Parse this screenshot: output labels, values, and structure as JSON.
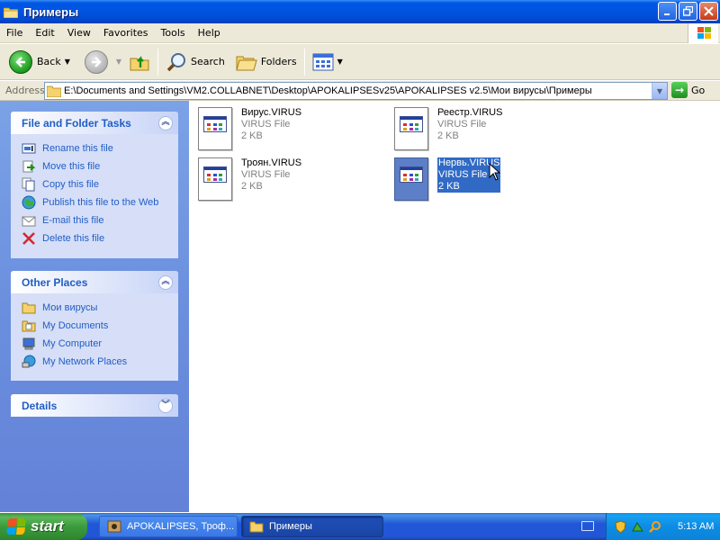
{
  "window": {
    "title": "Примеры"
  },
  "menu": [
    "File",
    "Edit",
    "View",
    "Favorites",
    "Tools",
    "Help"
  ],
  "toolbar": {
    "back_label": "Back",
    "search_label": "Search",
    "folders_label": "Folders"
  },
  "address": {
    "label": "Address",
    "value": "E:\\Documents and Settings\\VM2.COLLABNET\\Desktop\\APOKALIPSESv25\\APOKALIPSES v2.5\\Мои вирусы\\Примеры",
    "go_label": "Go"
  },
  "sidebar": {
    "tasks": {
      "title": "File and Folder Tasks",
      "items": [
        {
          "label": "Rename this file",
          "icon": "rename-icon"
        },
        {
          "label": "Move this file",
          "icon": "move-icon"
        },
        {
          "label": "Copy this file",
          "icon": "copy-icon"
        },
        {
          "label": "Publish this file to the Web",
          "icon": "publish-icon"
        },
        {
          "label": "E-mail this file",
          "icon": "email-icon"
        },
        {
          "label": "Delete this file",
          "icon": "delete-icon"
        }
      ]
    },
    "places": {
      "title": "Other Places",
      "items": [
        {
          "label": "Мои вирусы",
          "icon": "folder-icon"
        },
        {
          "label": "My Documents",
          "icon": "my-documents-icon"
        },
        {
          "label": "My Computer",
          "icon": "my-computer-icon"
        },
        {
          "label": "My Network Places",
          "icon": "network-places-icon"
        }
      ]
    },
    "details": {
      "title": "Details"
    }
  },
  "files": [
    {
      "name": "Вирус.VIRUS",
      "type": "VIRUS File",
      "size": "2 KB",
      "selected": false
    },
    {
      "name": "Реестр.VIRUS",
      "type": "VIRUS File",
      "size": "2 KB",
      "selected": false
    },
    {
      "name": "Троян.VIRUS",
      "type": "VIRUS File",
      "size": "2 KB",
      "selected": false
    },
    {
      "name": "Нервь.VIRUS",
      "type": "VIRUS File",
      "size": "2 KB",
      "selected": true
    }
  ],
  "taskbar": {
    "start_label": "start",
    "tasks": [
      {
        "label": "APOKALIPSES, Троф...",
        "active": false
      },
      {
        "label": "Примеры",
        "active": true
      }
    ],
    "clock": "5:13 AM"
  },
  "colors": {
    "titlebar": "#0054e3",
    "sidebar": "#6b8fde",
    "link": "#215dc6",
    "selection": "#316ac5",
    "start": "#3c9b3c"
  }
}
